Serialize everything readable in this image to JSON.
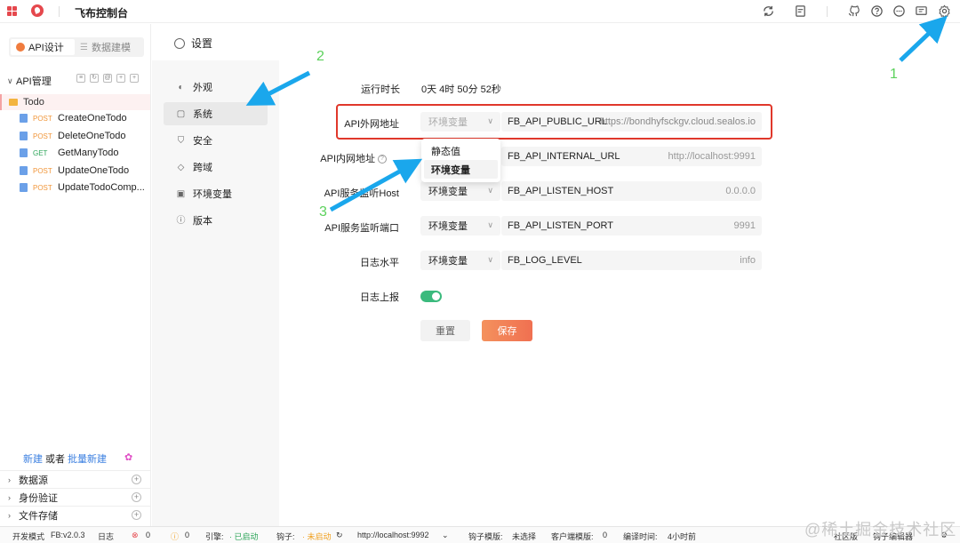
{
  "app": {
    "title": "飞布控制台"
  },
  "sidebar": {
    "modes": [
      {
        "label": "API设计",
        "active": true
      },
      {
        "label": "数据建模",
        "active": false
      }
    ],
    "tree_title": "API管理",
    "folder": "Todo",
    "apis": [
      {
        "method": "POST",
        "name": "CreateOneTodo"
      },
      {
        "method": "POST",
        "name": "DeleteOneTodo"
      },
      {
        "method": "GET",
        "name": "GetManyTodo"
      },
      {
        "method": "POST",
        "name": "UpdateOneTodo"
      },
      {
        "method": "POST",
        "name": "UpdateTodoComp..."
      }
    ],
    "new_link": "新建",
    "or_text": "或者",
    "batch_link": "批量新建",
    "sections": [
      "数据源",
      "身份验证",
      "文件存储"
    ]
  },
  "settings": {
    "title": "设置",
    "nav": [
      "外观",
      "系统",
      "安全",
      "跨域",
      "环境变量",
      "版本"
    ],
    "fields": {
      "uptime_label": "运行时长",
      "uptime_value": "0天 4时 50分 52秒",
      "public_url_label": "API外网地址",
      "public_url_select": "环境变量",
      "public_url_key": "FB_API_PUBLIC_URL",
      "public_url_value": "https://bondhyfsckgv.cloud.sealos.io",
      "internal_url_label": "API内网地址",
      "internal_url_key": "FB_API_INTERNAL_URL",
      "internal_url_value": "http://localhost:9991",
      "listen_host_label": "API服务监听Host",
      "listen_host_select": "环境变量",
      "listen_host_key": "FB_API_LISTEN_HOST",
      "listen_host_value": "0.0.0.0",
      "listen_port_label": "API服务监听端口",
      "listen_port_select": "环境变量",
      "listen_port_key": "FB_API_LISTEN_PORT",
      "listen_port_value": "9991",
      "log_level_label": "日志水平",
      "log_level_select": "环境变量",
      "log_level_key": "FB_LOG_LEVEL",
      "log_level_value": "info",
      "log_report_label": "日志上报",
      "log_report_on": true
    },
    "dropdown_options": [
      "静态值",
      "环境变量"
    ],
    "reset_label": "重置",
    "save_label": "保存"
  },
  "annotations": [
    "1",
    "2",
    "3"
  ],
  "statusbar": {
    "mode": "开发模式",
    "version": "FB:v2.0.3",
    "log": "日志",
    "errors": "0",
    "warnings": "0",
    "engine_label": "引擎:",
    "engine_status": "· 已启动",
    "hook_label": "钩子:",
    "hook_status": "· 未启动",
    "hook_url": "http://localhost:9992",
    "hook_template_label": "钩子模版:",
    "hook_template_value": "未选择",
    "client_template_label": "客户端模版:",
    "client_template_value": "0",
    "compile_time_label": "编译时间:",
    "compile_time_value": "4小时前",
    "community": "社区版",
    "hook_editor": "钩子编辑器"
  },
  "watermark": "@稀土掘金技术社区",
  "colors": {
    "accent": "#f07051",
    "highlight_border": "#e0382b",
    "annotation": "#5bd15b",
    "arrow": "#1aa7ec",
    "toggle_on": "#3bba7d"
  }
}
